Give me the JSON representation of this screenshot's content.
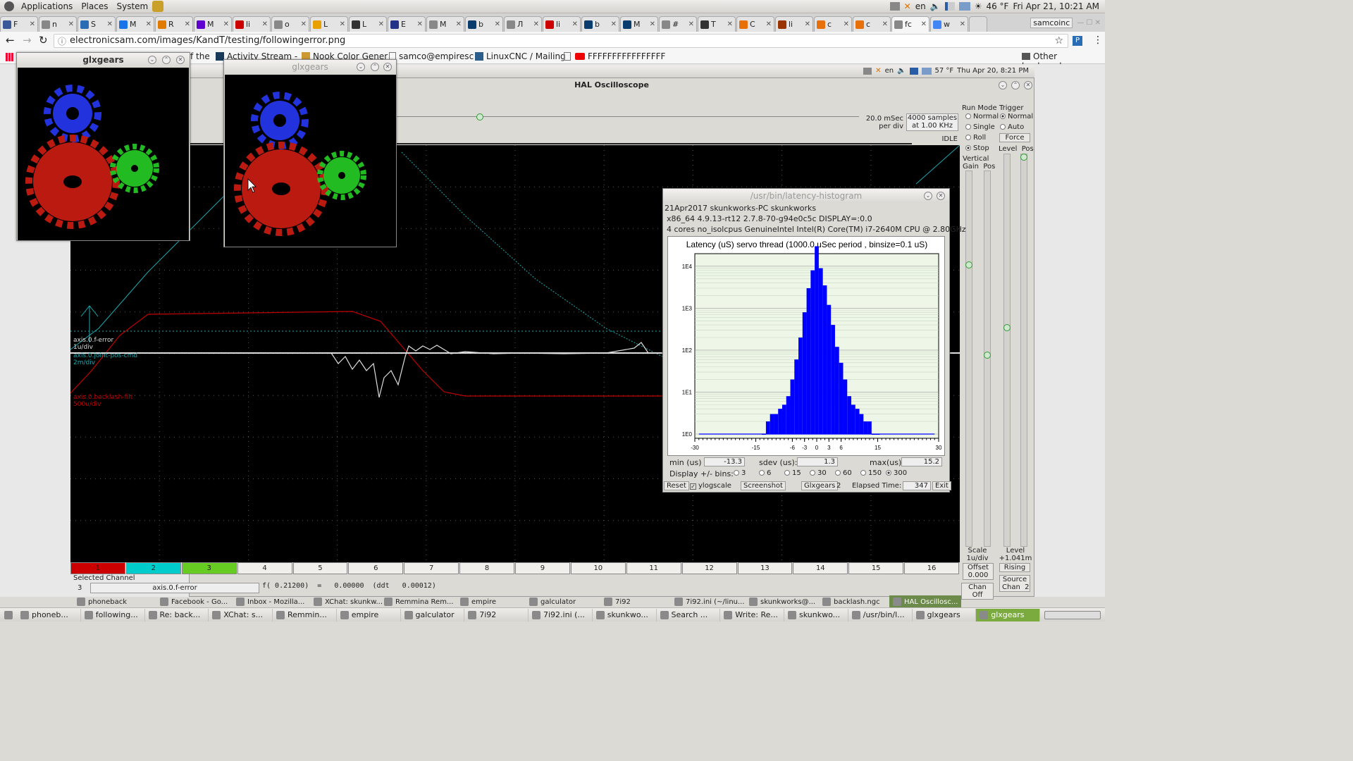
{
  "top_panel": {
    "menus": [
      "Applications",
      "Places",
      "System"
    ],
    "locale": "en",
    "weather": "46 °F",
    "clock": "Fri Apr 21, 10:21 AM"
  },
  "browser": {
    "tabs": [
      {
        "label": "F",
        "color": "#3b5998"
      },
      {
        "label": "n",
        "color": "#888"
      },
      {
        "label": "S",
        "color": "#2a6db5"
      },
      {
        "label": "M",
        "color": "#1a73e8"
      },
      {
        "label": "R",
        "color": "#e07b00"
      },
      {
        "label": "M",
        "color": "#5f01d1"
      },
      {
        "label": "li",
        "color": "#cc0000"
      },
      {
        "label": "o",
        "color": "#888"
      },
      {
        "label": "L",
        "color": "#e8a000"
      },
      {
        "label": "L",
        "color": "#333"
      },
      {
        "label": "E",
        "color": "#223388"
      },
      {
        "label": "M",
        "color": "#888"
      },
      {
        "label": "b",
        "color": "#0a3c6e"
      },
      {
        "label": "Л",
        "color": "#888"
      },
      {
        "label": "li",
        "color": "#cc0000"
      },
      {
        "label": "b",
        "color": "#0a3c6e"
      },
      {
        "label": "M",
        "color": "#0a3c6e"
      },
      {
        "label": "#",
        "color": "#888"
      },
      {
        "label": "T",
        "color": "#333"
      },
      {
        "label": "C",
        "color": "#e8700a"
      },
      {
        "label": "li",
        "color": "#993300"
      },
      {
        "label": "c",
        "color": "#e8700a"
      },
      {
        "label": "c",
        "color": "#e8700a"
      },
      {
        "label": "fc",
        "color": "#888"
      },
      {
        "label": "w",
        "color": "#4285f4"
      }
    ],
    "profile": "samcoinc",
    "url": "electronicsam.com/images/KandT/testing/followingerror.png",
    "bookmarks": [
      "f the",
      "Activity Stream - ",
      "Nook Color Gener",
      "samco@empiresc",
      "LinuxCNC / Mailing",
      "FFFFFFFFFFFFFFFF"
    ],
    "other_bookmarks": "Other bookmarks"
  },
  "inner_panel": {
    "locale": "en",
    "weather": "57 °F",
    "clock": "Thu Apr 20,  8:21 PM"
  },
  "halo": {
    "title": "HAL Oscilloscope",
    "timebase": "20.0 mSec\nper div",
    "samples": "4000 samples\nat 1.00 KHz",
    "status": "IDLE",
    "run_mode": {
      "label": "Run Mode",
      "options": [
        "Normal",
        "Single",
        "Roll",
        "Stop"
      ],
      "selected": "Stop"
    },
    "trigger": {
      "label": "Trigger",
      "options": [
        "Normal",
        "Auto"
      ],
      "selected": "Normal",
      "force": "Force",
      "level_pos": "Level  Pos"
    },
    "vertical": "Vertical\nGain  Pos",
    "scale": "Scale\n1u/div",
    "level": "Level\n+1.041m",
    "offset": "Offset\n0.000",
    "rising": "Rising",
    "chan_off": "Chan Off",
    "source": "Source\nChan  2",
    "channels": [
      "1",
      "2",
      "3",
      "4",
      "5",
      "6",
      "7",
      "8",
      "9",
      "10",
      "11",
      "12",
      "13",
      "14",
      "15",
      "16"
    ],
    "channel_colors": [
      "#cc0000",
      "#00cccc",
      "#66cc22"
    ],
    "selected_channel_label": "Selected Channel",
    "selected_channel_num": "3",
    "selected_channel_name": "axis.0.f-error",
    "readout": "f( 0.21200)  =   0.00000  (ddt   0.00012)",
    "traces": [
      {
        "name": "axis.0.f-error",
        "scale": "1u/div",
        "color": "#dddddd"
      },
      {
        "name": "axis.0.joint-pos-cmd",
        "scale": "2m/div",
        "color": "#1aa9b0"
      },
      {
        "name": "axis.0.backlash-filt",
        "scale": "500u/div",
        "color": "#c00000"
      }
    ]
  },
  "glx1": {
    "title": "glxgears"
  },
  "glx2": {
    "title": "glxgears"
  },
  "histo": {
    "title": "/usr/bin/latency-histogram",
    "info": [
      "21Apr2017 skunkworks-PC skunkworks",
      "x86_64  4.9.13-rt12  2.7.8-70-g94e0c5c  DISPLAY=:0.0",
      "4 cores  no_isolcpus  GenuineIntel  Intel(R) Core(TM) i7-2640M CPU @ 2.80GHz"
    ],
    "chart_data": {
      "type": "bar",
      "title": "Latency (uS) servo thread (1000.0 uSec period , binsize=0.1 uS)",
      "xlim": [
        -30,
        30
      ],
      "x_ticks": [
        -30,
        -15,
        -6,
        -3,
        0,
        3,
        6,
        15,
        30
      ],
      "y_ticks": [
        "1E0",
        "1E1",
        "1E2",
        "1E3",
        "1E4"
      ],
      "y_scale": "log",
      "x": [
        -13,
        -12,
        -11,
        -10,
        -9,
        -8,
        -7,
        -6,
        -5,
        -4,
        -3,
        -2,
        -1,
        0,
        1,
        2,
        3,
        4,
        5,
        6,
        7,
        8,
        9,
        10,
        11,
        12,
        13,
        14,
        15
      ],
      "values": [
        1,
        2,
        3,
        3,
        4,
        5,
        8,
        20,
        60,
        200,
        800,
        3000,
        8000,
        30000,
        9000,
        3500,
        1200,
        400,
        120,
        50,
        20,
        8,
        5,
        4,
        3,
        2,
        2,
        1,
        1
      ],
      "color": "#0000ff"
    },
    "min_label": "min (us)",
    "min": "-13.3",
    "sdev_label": "sdev (us):",
    "sdev": "1.3",
    "max_label": "max(us)",
    "max": "15.2",
    "bins_label": "Display +/- bins:",
    "bins": [
      "3",
      "6",
      "15",
      "30",
      "60",
      "150",
      "300"
    ],
    "bins_selected": "300",
    "reset": "Reset",
    "ylogscale": "ylogscale",
    "screenshot": "Screenshot",
    "glxgears": "Glxgears",
    "glx_count": "2",
    "elapsed_label": "Elapsed Time:",
    "elapsed": "347",
    "exit": "Exit"
  },
  "taskbar_inner": [
    "phoneback",
    "Facebook - Go...",
    "Inbox - Mozilla...",
    "XChat: skunkw...",
    "Remmina Rem...",
    "empire",
    "galculator",
    "7i92",
    "7i92.ini (~/linu...",
    "skunkworks@...",
    "backlash.ngc",
    "HAL Oscillosc..."
  ],
  "taskbar": [
    "phoneb...",
    "following...",
    "Re: back...",
    "XChat: s...",
    "Remmin...",
    "empire",
    "galculator",
    "7i92",
    "7i92.ini (...",
    "skunkwo...",
    "Search ...",
    "Write: Re...",
    "skunkwo...",
    "/usr/bin/l...",
    "glxgears",
    "glxgears"
  ]
}
